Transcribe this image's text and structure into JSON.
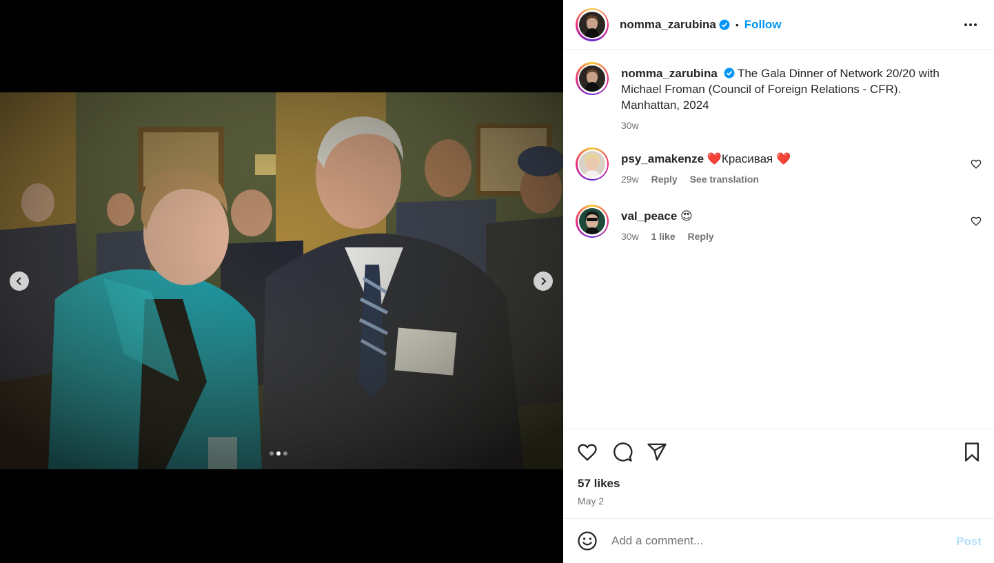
{
  "post": {
    "username": "nomma_zarubina",
    "follow_label": "Follow",
    "separator": "•",
    "caption": "The Gala Dinner of Network 20/20 with Michael Froman (Council of Foreign Relations - CFR). Manhattan, 2024",
    "caption_time": "30w",
    "likes": "57 likes",
    "date": "May 2",
    "name_badge": [
      "Michael Froman",
      "Council on Foreign Relations"
    ],
    "carousel": {
      "count": 3,
      "active": 1
    }
  },
  "comments": [
    {
      "username": "psy_amakenze",
      "text": "❤️Красивая ❤️",
      "time": "29w",
      "likes": "",
      "reply": "Reply",
      "translate": "See translation"
    },
    {
      "username": "val_peace",
      "text": "😍",
      "time": "30w",
      "likes": "1 like",
      "reply": "Reply",
      "translate": ""
    }
  ],
  "composer": {
    "placeholder": "Add a comment...",
    "post_label": "Post"
  },
  "icons": {
    "verified": "verified-badge-icon",
    "more": "more-options-icon",
    "like": "heart-icon",
    "comment": "comment-icon",
    "share": "share-icon",
    "save": "bookmark-icon",
    "emoji": "emoji-icon",
    "prev": "chevron-left-icon",
    "next": "chevron-right-icon"
  },
  "colors": {
    "accent": "#0095f6",
    "muted": "#737373",
    "post_disabled": "#b2dffc"
  }
}
